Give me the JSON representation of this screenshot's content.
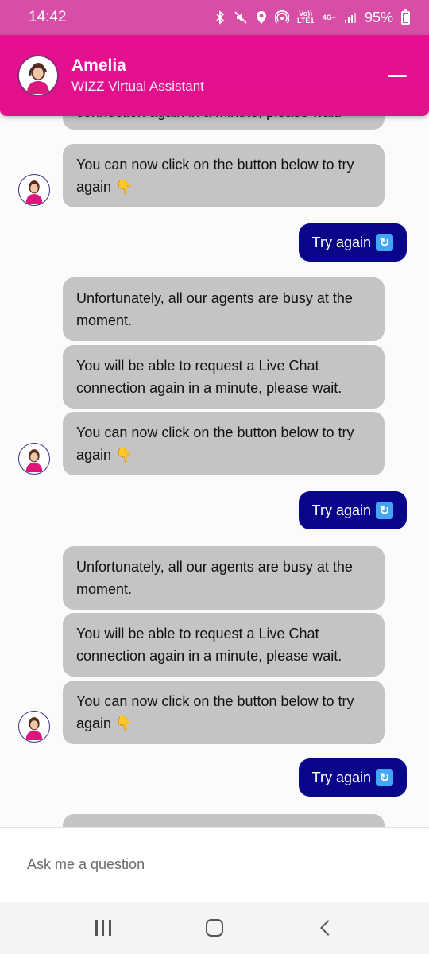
{
  "status_bar": {
    "time": "14:42",
    "battery": "95%",
    "network_label_top": "Vo)) LTE1",
    "network_label_4g": "4G+",
    "icons": [
      "bluetooth-icon",
      "mute-icon",
      "location-icon",
      "hotspot-icon",
      "signal-icon",
      "battery-icon"
    ]
  },
  "header": {
    "name": "Amelia",
    "subtitle": "WIZZ Virtual Assistant",
    "minimize_icon": "minimize-icon",
    "brand_color": "#e60f92"
  },
  "messages": {
    "partial_top": "connection again in a minute, please wait.",
    "click_try": "You can now click on the button below to try again",
    "busy": "Unfortunately, all our agents are busy at the moment.",
    "request_live": "You will be able to request a Live Chat connection again in a minute, please wait.",
    "try_again_label": "Try again",
    "try_again_icon": "refresh-icon",
    "point_icon": "pointing-down-icon",
    "user_bubble_color": "#09068a",
    "bot_bubble_color": "#c4c4c4"
  },
  "input": {
    "placeholder": "Ask me a question"
  },
  "navbar": {
    "items": [
      "recents-icon",
      "home-icon",
      "back-icon"
    ]
  }
}
